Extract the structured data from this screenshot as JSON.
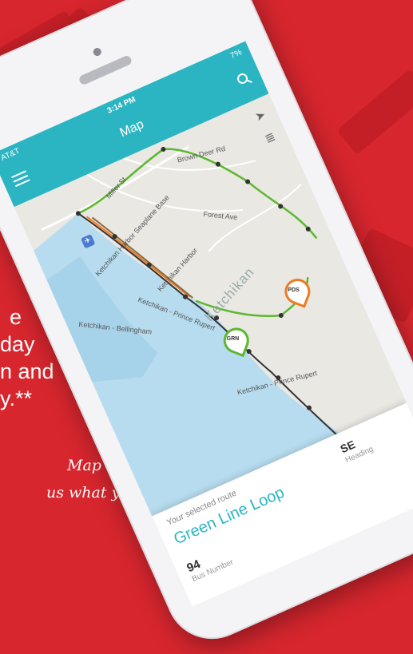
{
  "status": {
    "carrier": "AT&T",
    "time": "3:14 PM",
    "battery": "7%"
  },
  "appbar": {
    "title": "Map"
  },
  "map": {
    "town": "Ketchikan",
    "streets": [
      "Brown Deer Rd",
      "Miller St",
      "Forest Ave"
    ],
    "water": [
      {
        "name": "Ketchikan Harbor Seaplane Base"
      },
      {
        "name": "Ketchikan Harbor"
      },
      {
        "name": "Ketchikan - Bellingham"
      },
      {
        "name": "Ketchikan - Prince Rupert"
      },
      {
        "name": "Ketchikan - Prince Rupert"
      }
    ],
    "markers": {
      "green": "GRN",
      "orange": "PDS"
    },
    "route_colors": {
      "green": "#5cb82e",
      "orange": "#f07a22",
      "dark": "#333333",
      "brown": "#8b6b3d"
    }
  },
  "sheet": {
    "caption": "Your selected route",
    "route_name": "Green Line Loop",
    "heading_value": "SE",
    "heading_label": "Heading",
    "bus_value": "94",
    "bus_label": "Bus Number"
  },
  "promo": {
    "lines": [
      "e",
      "day",
      "n and",
      "y.**"
    ],
    "hand_lines": [
      "Map app,",
      "us what you think!"
    ]
  }
}
